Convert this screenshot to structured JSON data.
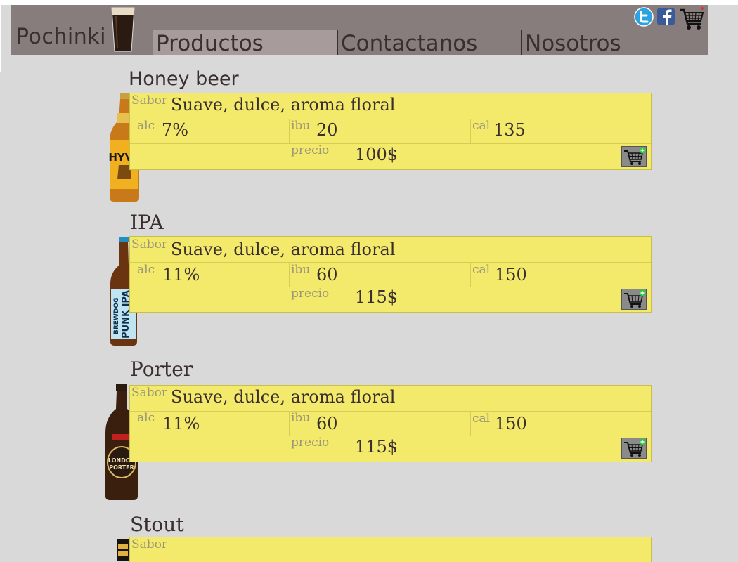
{
  "header": {
    "brand": "Pochinki",
    "nav": [
      {
        "label": "Productos",
        "active": true
      },
      {
        "label": "Contactanos",
        "active": false
      },
      {
        "label": "Nosotros",
        "active": false
      }
    ],
    "icons": [
      "twitter-icon",
      "facebook-icon",
      "cart-icon"
    ]
  },
  "labels": {
    "flavor": "Sabor",
    "alc": "alc",
    "ibu": "ibu",
    "cal": "cal",
    "price": "precio"
  },
  "products": [
    {
      "name": "Honey beer",
      "flavor": "Suave, dulce, aroma floral",
      "alc": "7%",
      "ibu": "20",
      "cal": "135",
      "price": "100$",
      "bottle_label": "HYVE"
    },
    {
      "name": "IPA",
      "flavor": "Suave, dulce, aroma floral",
      "alc": "11%",
      "ibu": "60",
      "cal": "150",
      "price": "115$",
      "bottle_label": "PUNK IPA"
    },
    {
      "name": "Porter",
      "flavor": "Suave, dulce, aroma floral",
      "alc": "11%",
      "ibu": "60",
      "cal": "150",
      "price": "115$",
      "bottle_label": "LONDON PORTER"
    },
    {
      "name": "Stout",
      "flavor": "",
      "alc": "",
      "ibu": "",
      "cal": "",
      "price": ""
    }
  ],
  "colors": {
    "header_bg": "#887d7d",
    "card_bg": "#f3ea6b",
    "page_bg": "#d9d9d9"
  }
}
